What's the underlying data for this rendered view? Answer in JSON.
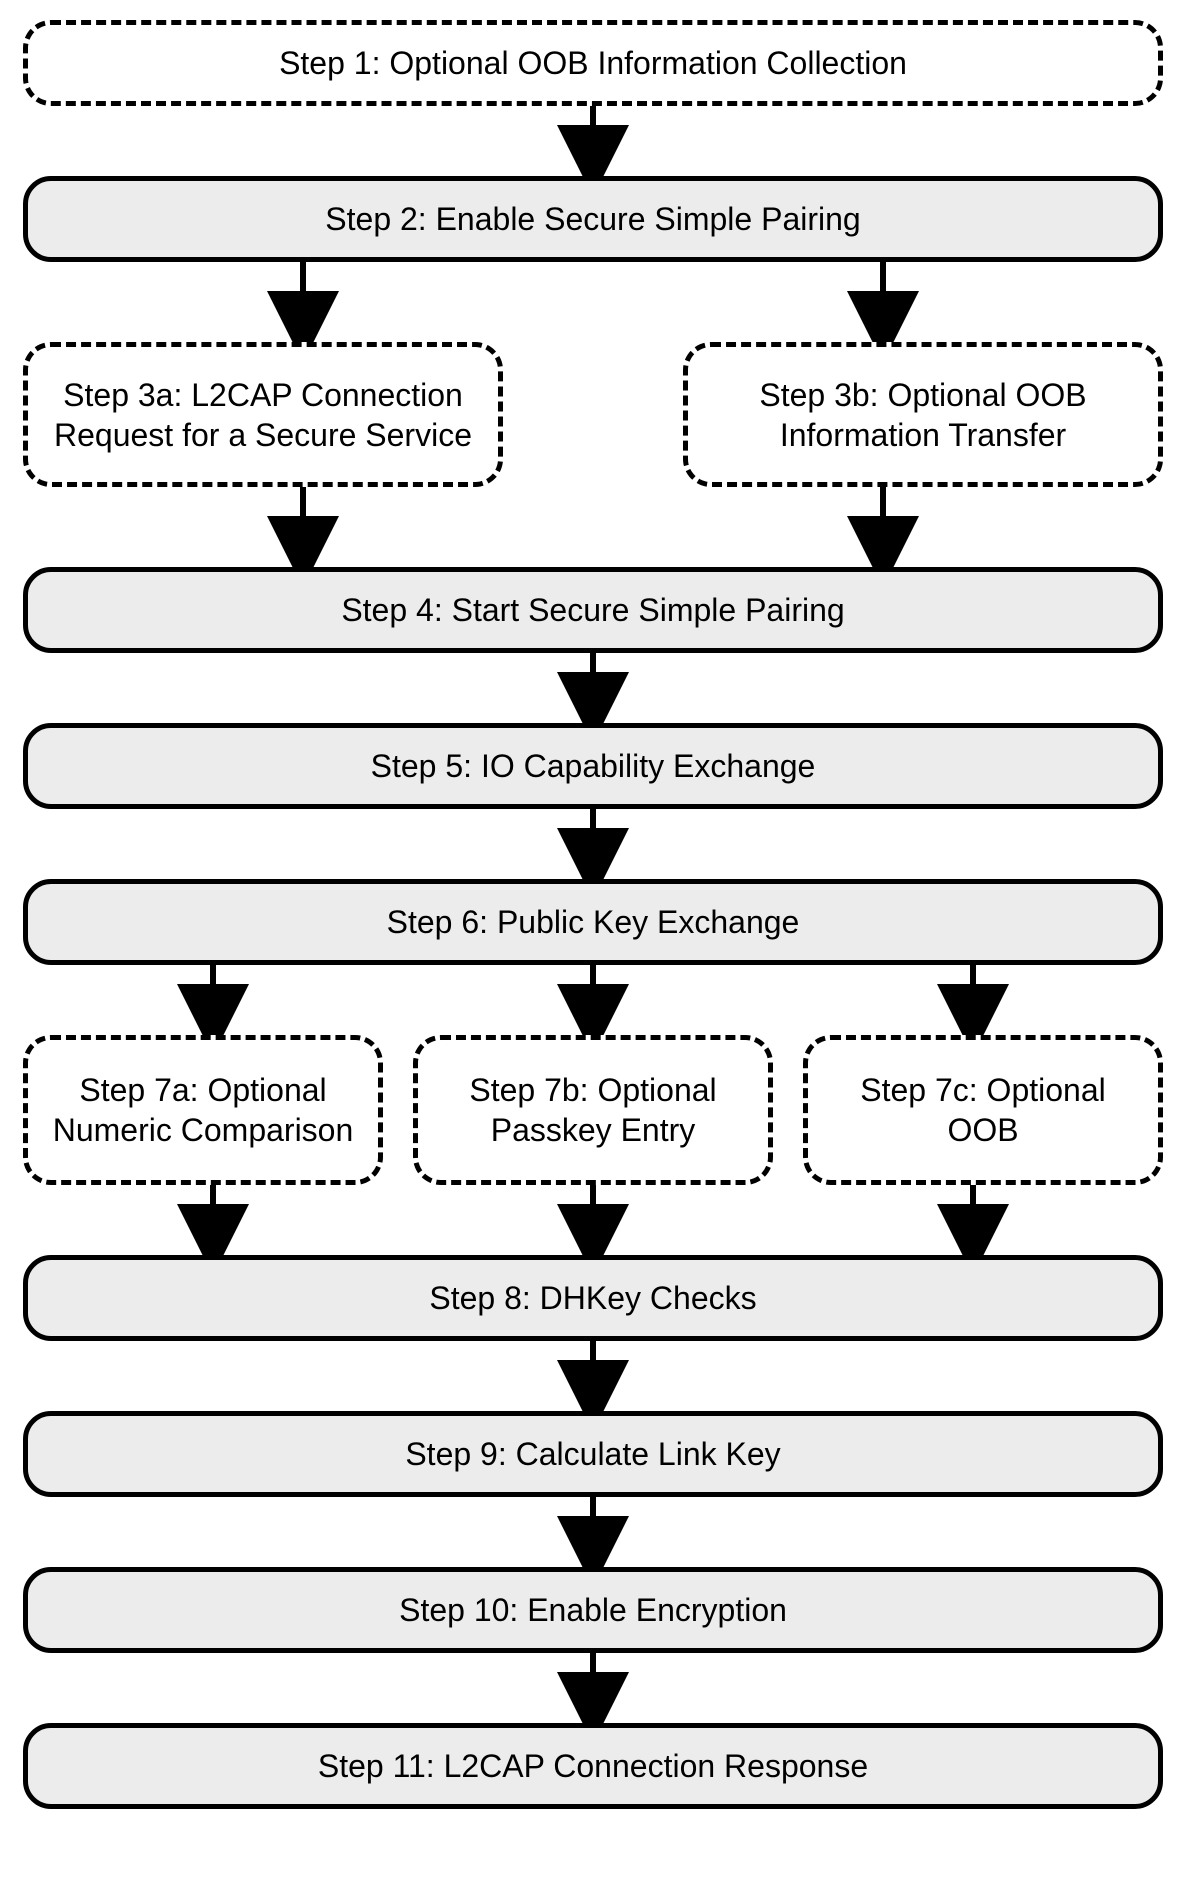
{
  "steps": {
    "s1": "Step 1:  Optional OOB Information Collection",
    "s2": "Step 2:  Enable Secure Simple Pairing",
    "s3a": "Step 3a:  L2CAP Connection Request for a Secure Service",
    "s3b": "Step 3b:  Optional OOB Information Transfer",
    "s4": "Step 4:  Start Secure Simple Pairing",
    "s5": "Step 5:  IO Capability Exchange",
    "s6": "Step 6:  Public Key Exchange",
    "s7a": "Step 7a:  Optional Numeric Comparison",
    "s7b": "Step 7b:  Optional Passkey Entry",
    "s7c": "Step 7c:  Optional OOB",
    "s8": "Step 8:  DHKey Checks",
    "s9": "Step 9:  Calculate Link Key",
    "s10": "Step 10:  Enable Encryption",
    "s11": "Step 11:  L2CAP Connection Response"
  }
}
